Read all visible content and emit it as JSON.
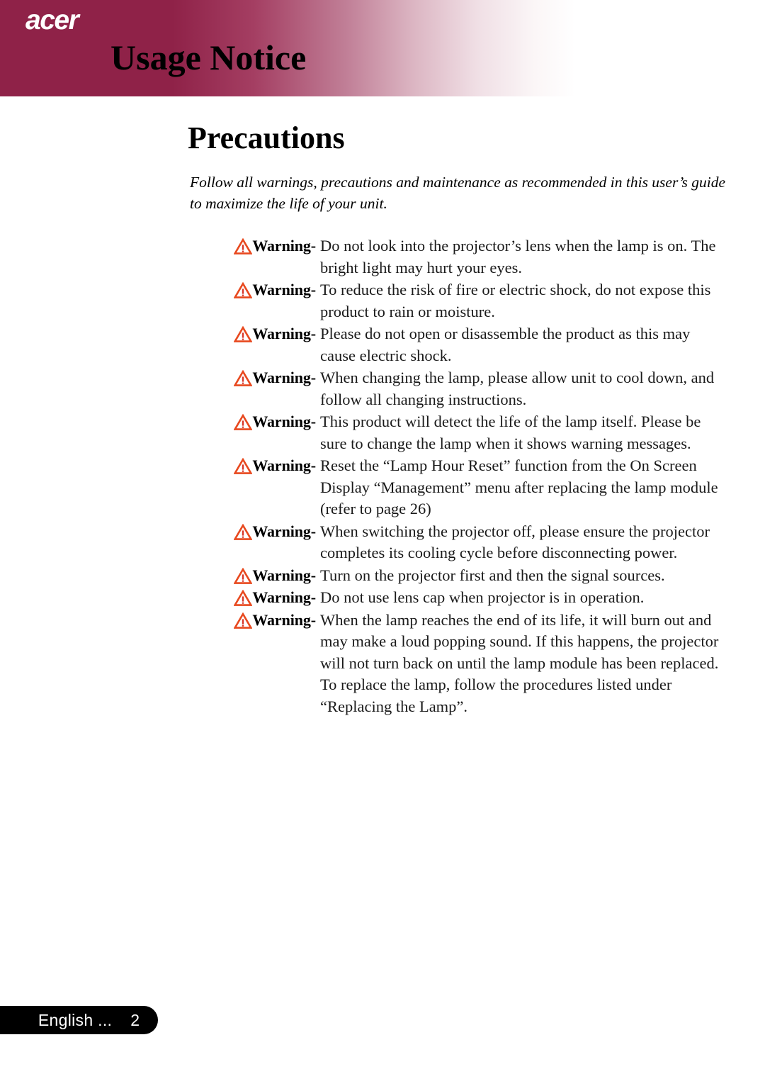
{
  "header": {
    "brand": "acer",
    "title": "Usage Notice",
    "band_color_left": "#8f2248",
    "band_color_right": "#ffffff"
  },
  "page": {
    "title": "Precautions",
    "intro": "Follow all warnings, precautions and maintenance as recommended in this user’s guide to maximize the life of your unit.",
    "warning_icon_color": "#e8491f"
  },
  "warnings": [
    {
      "label": "Warning-",
      "text": "Do not look into the projector’s lens when the lamp is on.  The bright light may hurt your eyes."
    },
    {
      "label": "Warning-",
      "text": "To reduce the risk of fire or electric shock, do not expose this product to rain or moisture."
    },
    {
      "label": "Warning-",
      "text": "Please do not open or disassemble the product as this may cause electric shock."
    },
    {
      "label": "Warning-",
      "text": "When changing the lamp, please allow unit to cool down, and follow all changing instructions."
    },
    {
      "label": "Warning-",
      "text": "This product will detect the life of the lamp itself. Please be sure to change the lamp when it shows warning messages."
    },
    {
      "label": "Warning-",
      "text": "Reset the “Lamp Hour Reset” function from the On Screen Display “Management” menu after replacing the lamp module (refer to page 26)"
    },
    {
      "label": "Warning-",
      "text": "When switching the projector off, please ensure the projector completes its cooling cycle before disconnecting power."
    },
    {
      "label": "Warning-",
      "text": "Turn on the projector first and then the signal sources."
    },
    {
      "label": "Warning-",
      "text": "Do not use lens cap when projector is in operation."
    },
    {
      "label": "Warning-",
      "text": "When the lamp reaches the end of its life, it will burn out and may make a loud popping sound.  If this happens, the projector will not turn back on until the lamp module has been replaced. To replace the lamp, follow the procedures listed under “Replacing the Lamp”."
    }
  ],
  "footer": {
    "language": "English ...",
    "page_number": "2",
    "background": "#000000"
  }
}
